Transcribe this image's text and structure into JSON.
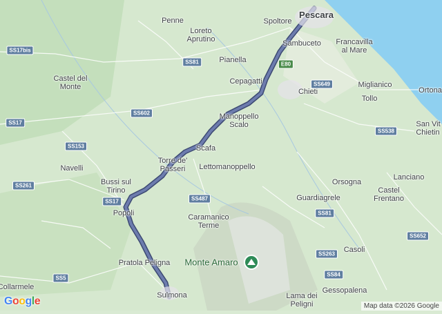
{
  "map": {
    "places": [
      {
        "id": "pescara",
        "label": "Pescara"
      },
      {
        "id": "penne",
        "label": "Penne"
      },
      {
        "id": "loreto",
        "label": "Loreto\nAprutino"
      },
      {
        "id": "spoltore",
        "label": "Spoltore"
      },
      {
        "id": "sambuceto",
        "label": "Sambuceto"
      },
      {
        "id": "francavilla",
        "label": "Francavilla\nal Mare"
      },
      {
        "id": "castel-del-monte",
        "label": "Castel del\nMonte"
      },
      {
        "id": "pianella",
        "label": "Pianella"
      },
      {
        "id": "cepagatti",
        "label": "Cepagatti"
      },
      {
        "id": "chieti",
        "label": "Chieti"
      },
      {
        "id": "miglianico",
        "label": "Miglianico"
      },
      {
        "id": "ortona",
        "label": "Ortona"
      },
      {
        "id": "tollo",
        "label": "Tollo"
      },
      {
        "id": "manoppello",
        "label": "Manoppello\nScalo"
      },
      {
        "id": "san-vito",
        "label": "San Vit\nChietin"
      },
      {
        "id": "navelli",
        "label": "Navelli"
      },
      {
        "id": "scafa",
        "label": "Scafa"
      },
      {
        "id": "torre",
        "label": "Torre de'\nPasseri"
      },
      {
        "id": "lettomanoppello",
        "label": "Lettomanoppello"
      },
      {
        "id": "lanciano",
        "label": "Lanciano"
      },
      {
        "id": "bussi",
        "label": "Bussi sul\nTirino"
      },
      {
        "id": "orsogna",
        "label": "Orsogna"
      },
      {
        "id": "castel-frentano",
        "label": "Castel\nFrentano"
      },
      {
        "id": "guardiagrele",
        "label": "Guardiagrele"
      },
      {
        "id": "popoli",
        "label": "Popoli"
      },
      {
        "id": "caramanico",
        "label": "Caramanico\nTerme"
      },
      {
        "id": "casoli",
        "label": "Casoli"
      },
      {
        "id": "pratola",
        "label": "Pratola Peligna"
      },
      {
        "id": "collarmele",
        "label": "Collarmele"
      },
      {
        "id": "gessopalena",
        "label": "Gessopalena"
      },
      {
        "id": "sulmona",
        "label": "Sulmona"
      },
      {
        "id": "lama",
        "label": "Lama dei\nPeligni"
      }
    ],
    "road_shields": [
      {
        "id": "ss17bis",
        "label": "SS17bis",
        "color": "#5f7ea0"
      },
      {
        "id": "ss81a",
        "label": "SS81",
        "color": "#5f7ea0"
      },
      {
        "id": "e80",
        "label": "E80",
        "color": "#4a8b4a"
      },
      {
        "id": "ss649",
        "label": "SS649",
        "color": "#5f7ea0"
      },
      {
        "id": "ss602",
        "label": "SS602",
        "color": "#5f7ea0"
      },
      {
        "id": "ss17a",
        "label": "SS17",
        "color": "#5f7ea0"
      },
      {
        "id": "ss538",
        "label": "SS538",
        "color": "#5f7ea0"
      },
      {
        "id": "ss153",
        "label": "SS153",
        "color": "#5f7ea0"
      },
      {
        "id": "ss261",
        "label": "SS261",
        "color": "#5f7ea0"
      },
      {
        "id": "ss17b",
        "label": "SS17",
        "color": "#5f7ea0"
      },
      {
        "id": "ss487",
        "label": "SS487",
        "color": "#5f7ea0"
      },
      {
        "id": "ss81b",
        "label": "SS81",
        "color": "#5f7ea0"
      },
      {
        "id": "ss652",
        "label": "SS652",
        "color": "#5f7ea0"
      },
      {
        "id": "ss263",
        "label": "SS263",
        "color": "#5f7ea0"
      },
      {
        "id": "ss5",
        "label": "SS5",
        "color": "#5f7ea0"
      },
      {
        "id": "ss84",
        "label": "SS84",
        "color": "#5f7ea0"
      }
    ],
    "peak": {
      "label": "Monte Amaro",
      "icon": "mountain-icon"
    },
    "route": {
      "from": "Pescara",
      "to": "Sulmona",
      "color": "#4e5d85"
    },
    "sea_color": "#8fd0f0",
    "land_color": "#d9ead3",
    "attribution": "Map data ©2026 Google",
    "logo": "Google"
  }
}
